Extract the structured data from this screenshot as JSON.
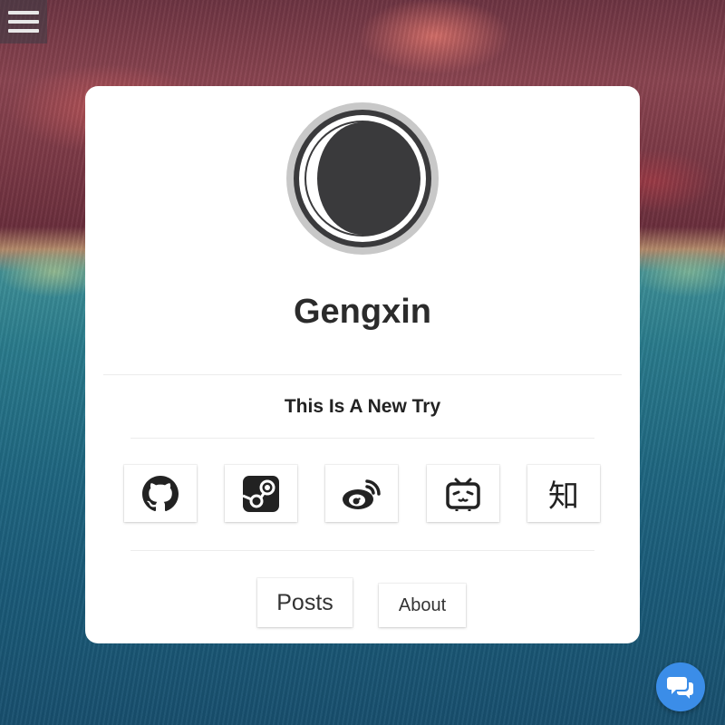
{
  "profile": {
    "name": "Gengxin",
    "tagline": "This Is A New Try"
  },
  "social": {
    "items": [
      {
        "icon": "github-icon"
      },
      {
        "icon": "steam-icon"
      },
      {
        "icon": "weibo-icon"
      },
      {
        "icon": "bilibili-icon"
      },
      {
        "icon": "zhihu-icon",
        "glyph": "知"
      }
    ]
  },
  "nav": {
    "posts_label": "Posts",
    "about_label": "About"
  },
  "colors": {
    "accent": "#3b8de8",
    "card": "#ffffff",
    "text": "#2b2b2b"
  }
}
